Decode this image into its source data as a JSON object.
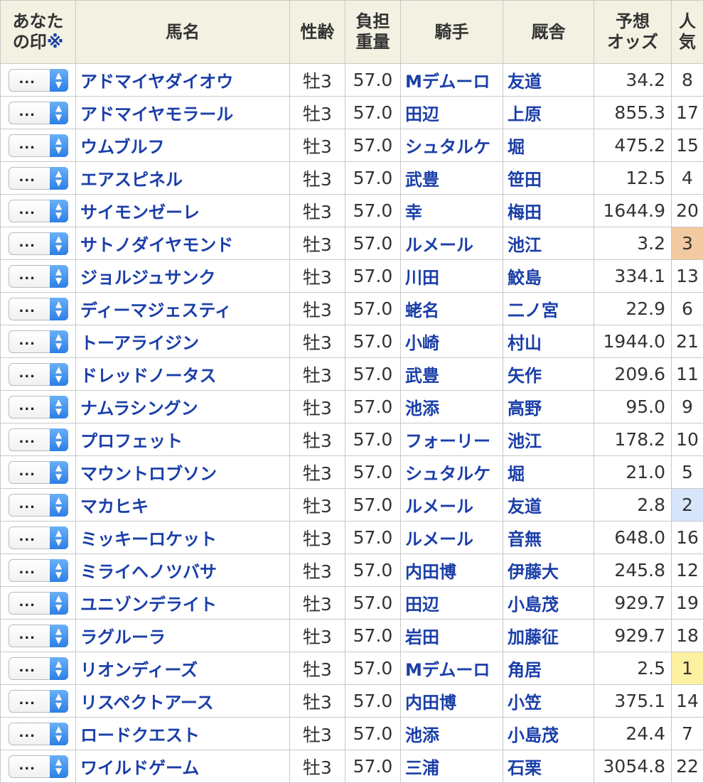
{
  "header": {
    "mark_line1": "あなた",
    "mark_line2": "の印",
    "mark_note": "※",
    "name": "馬名",
    "sex_age": "性齢",
    "weight_line1": "負担",
    "weight_line2": "重量",
    "jockey": "騎手",
    "stable": "厩舎",
    "odds_line1": "予想",
    "odds_line2": "オッズ",
    "pop_line1": "人",
    "pop_line2": "気"
  },
  "select_value": "...",
  "colors": {
    "link": "#1a3ea8",
    "header_bg": "#f2f1e2",
    "pop1": "#fcf1a0",
    "pop2": "#d7e6fb",
    "pop3": "#f2c9a0"
  },
  "rows": [
    {
      "name": "アドマイヤダイオウ",
      "sex_age": "牡3",
      "weight": "57.0",
      "jockey": "Mデムーロ",
      "stable": "友道",
      "odds": "34.2",
      "pop": "8"
    },
    {
      "name": "アドマイヤモラール",
      "sex_age": "牡3",
      "weight": "57.0",
      "jockey": "田辺",
      "stable": "上原",
      "odds": "855.3",
      "pop": "17"
    },
    {
      "name": "ウムブルフ",
      "sex_age": "牡3",
      "weight": "57.0",
      "jockey": "シュタルケ",
      "stable": "堀",
      "odds": "475.2",
      "pop": "15"
    },
    {
      "name": "エアスピネル",
      "sex_age": "牡3",
      "weight": "57.0",
      "jockey": "武豊",
      "stable": "笹田",
      "odds": "12.5",
      "pop": "4"
    },
    {
      "name": "サイモンゼーレ",
      "sex_age": "牡3",
      "weight": "57.0",
      "jockey": "幸",
      "stable": "梅田",
      "odds": "1644.9",
      "pop": "20"
    },
    {
      "name": "サトノダイヤモンド",
      "sex_age": "牡3",
      "weight": "57.0",
      "jockey": "ルメール",
      "stable": "池江",
      "odds": "3.2",
      "pop": "3"
    },
    {
      "name": "ジョルジュサンク",
      "sex_age": "牡3",
      "weight": "57.0",
      "jockey": "川田",
      "stable": "鮫島",
      "odds": "334.1",
      "pop": "13"
    },
    {
      "name": "ディーマジェスティ",
      "sex_age": "牡3",
      "weight": "57.0",
      "jockey": "蛯名",
      "stable": "二ノ宮",
      "odds": "22.9",
      "pop": "6"
    },
    {
      "name": "トーアライジン",
      "sex_age": "牡3",
      "weight": "57.0",
      "jockey": "小崎",
      "stable": "村山",
      "odds": "1944.0",
      "pop": "21"
    },
    {
      "name": "ドレッドノータス",
      "sex_age": "牡3",
      "weight": "57.0",
      "jockey": "武豊",
      "stable": "矢作",
      "odds": "209.6",
      "pop": "11"
    },
    {
      "name": "ナムラシングン",
      "sex_age": "牡3",
      "weight": "57.0",
      "jockey": "池添",
      "stable": "高野",
      "odds": "95.0",
      "pop": "9"
    },
    {
      "name": "プロフェット",
      "sex_age": "牡3",
      "weight": "57.0",
      "jockey": "フォーリー",
      "stable": "池江",
      "odds": "178.2",
      "pop": "10"
    },
    {
      "name": "マウントロブソン",
      "sex_age": "牡3",
      "weight": "57.0",
      "jockey": "シュタルケ",
      "stable": "堀",
      "odds": "21.0",
      "pop": "5"
    },
    {
      "name": "マカヒキ",
      "sex_age": "牡3",
      "weight": "57.0",
      "jockey": "ルメール",
      "stable": "友道",
      "odds": "2.8",
      "pop": "2"
    },
    {
      "name": "ミッキーロケット",
      "sex_age": "牡3",
      "weight": "57.0",
      "jockey": "ルメール",
      "stable": "音無",
      "odds": "648.0",
      "pop": "16"
    },
    {
      "name": "ミライヘノツバサ",
      "sex_age": "牡3",
      "weight": "57.0",
      "jockey": "内田博",
      "stable": "伊藤大",
      "odds": "245.8",
      "pop": "12"
    },
    {
      "name": "ユニゾンデライト",
      "sex_age": "牡3",
      "weight": "57.0",
      "jockey": "田辺",
      "stable": "小島茂",
      "odds": "929.7",
      "pop": "19"
    },
    {
      "name": "ラグルーラ",
      "sex_age": "牡3",
      "weight": "57.0",
      "jockey": "岩田",
      "stable": "加藤征",
      "odds": "929.7",
      "pop": "18"
    },
    {
      "name": "リオンディーズ",
      "sex_age": "牡3",
      "weight": "57.0",
      "jockey": "Mデムーロ",
      "stable": "角居",
      "odds": "2.5",
      "pop": "1"
    },
    {
      "name": "リスペクトアース",
      "sex_age": "牡3",
      "weight": "57.0",
      "jockey": "内田博",
      "stable": "小笠",
      "odds": "375.1",
      "pop": "14"
    },
    {
      "name": "ロードクエスト",
      "sex_age": "牡3",
      "weight": "57.0",
      "jockey": "池添",
      "stable": "小島茂",
      "odds": "24.4",
      "pop": "7"
    },
    {
      "name": "ワイルドゲーム",
      "sex_age": "牡3",
      "weight": "57.0",
      "jockey": "三浦",
      "stable": "石栗",
      "odds": "3054.8",
      "pop": "22"
    }
  ]
}
